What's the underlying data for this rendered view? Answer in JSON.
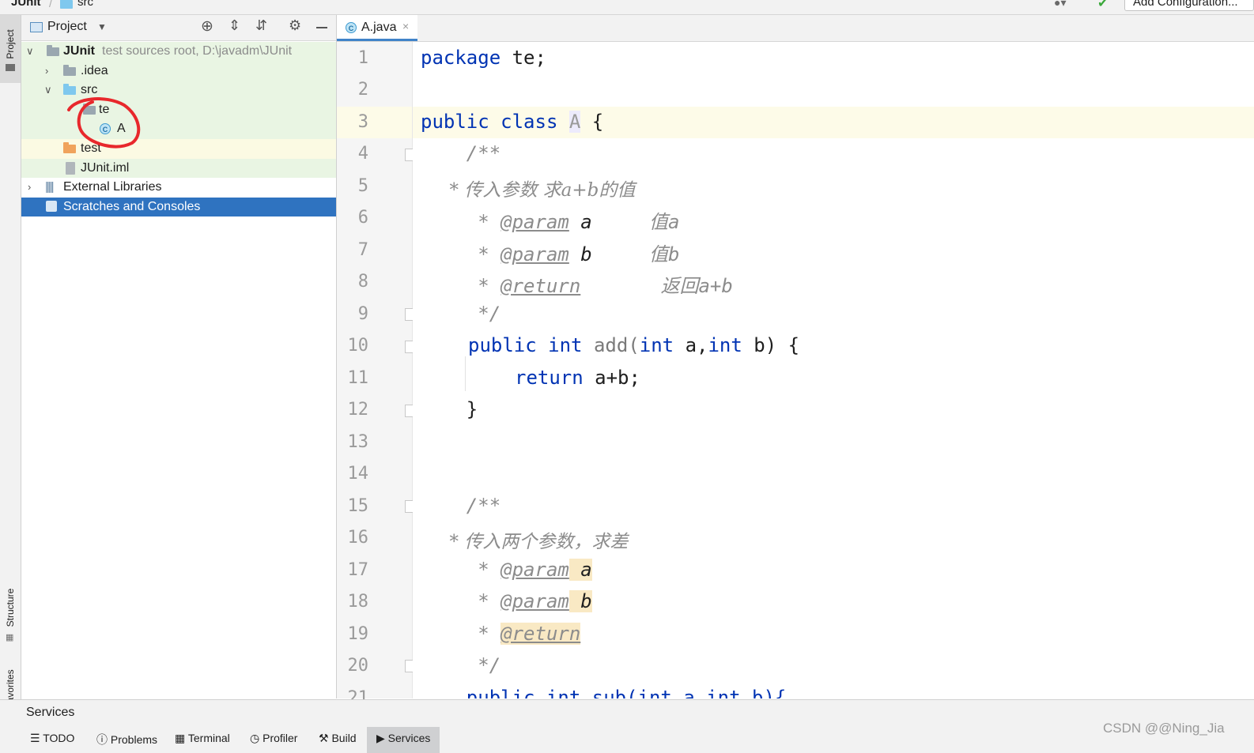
{
  "breadcrumb": {
    "project": "JUnit",
    "folder": "src"
  },
  "toolbar": {
    "run_config": "Add Configuration..."
  },
  "left_stripe": {
    "project_tab": "Project",
    "structure_tab": "Structure",
    "favorites_tab": "Favorites"
  },
  "project_panel": {
    "title": "Project",
    "tree": [
      {
        "name": "JUnit",
        "hint": "test sources root,  D:\\javadm\\JUnit"
      },
      {
        "name": ".idea"
      },
      {
        "name": "src"
      },
      {
        "name": "te"
      },
      {
        "name": "A"
      },
      {
        "name": "test"
      },
      {
        "name": "JUnit.iml"
      },
      {
        "name": "External Libraries"
      },
      {
        "name": "Scratches and Consoles"
      }
    ]
  },
  "editor": {
    "tab_label": "A.java",
    "line_numbers": [
      "1",
      "2",
      "3",
      "4",
      "5",
      "6",
      "7",
      "8",
      "9",
      "10",
      "11",
      "12",
      "13",
      "14",
      "15",
      "16",
      "17",
      "18",
      "19",
      "20",
      "21"
    ],
    "code": {
      "l1_kw": "package",
      "l1_rest": " te;",
      "l3_kw1": "public",
      "l3_kw2": "class",
      "l3_name": "A",
      "l3_rest": " {",
      "l4": "    /**",
      "l5": "     * 传入参数 求a+b的值",
      "l6_star": "     * ",
      "l6_tag": "@param",
      "l6_name": " a",
      "l6_desc": "     值a",
      "l7_star": "     * ",
      "l7_tag": "@param",
      "l7_name": " b",
      "l7_desc": "     值b",
      "l8_star": "     * ",
      "l8_tag": "@return",
      "l8_desc": "       返回a+b",
      "l9": "     */",
      "l10_kw": "public",
      "l10_kw2": "int",
      "l10_name": " add(",
      "l10_kw3": "int",
      "l10_a": " a,",
      "l10_kw4": "int",
      "l10_b": " b) {",
      "l11_kw": "return",
      "l11_rest": " a+b;",
      "l12": "    }",
      "l15": "    /**",
      "l16": "     * 传入两个参数，求差",
      "l17_star": "     * ",
      "l17_tag": "@param",
      "l17_name": " a",
      "l18_star": "     * ",
      "l18_tag": "@param",
      "l18_name": " b",
      "l19_star": "     * ",
      "l19_tag": "@return",
      "l20": "     */",
      "l21": "    public int sub(int a,int b){"
    }
  },
  "services_label": "Services",
  "bottom_tabs": [
    "TODO",
    "Problems",
    "Terminal",
    "Profiler",
    "Build",
    "Services"
  ],
  "watermark": "CSDN @@Ning_Jia"
}
